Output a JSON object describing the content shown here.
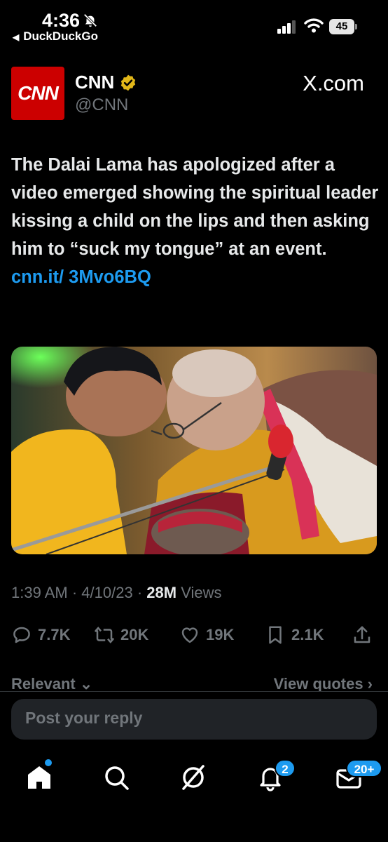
{
  "status_bar": {
    "time": "4:36",
    "back_app": "DuckDuckGo",
    "battery": "45"
  },
  "tweet": {
    "display_name": "CNN",
    "handle": "@CNN",
    "source": "X.com",
    "avatar_text": "CNN",
    "text": "The Dalai Lama has apologized after a video emerged showing the spiritual leader kissing a child on the lips and then asking him to “suck my tongue” at an event. ",
    "link": "cnn.it/ 3Mvo6BQ",
    "time": "1:39 AM",
    "date": "4/10/23",
    "views_count": "28M",
    "views_label": "Views"
  },
  "actions": {
    "replies": "7.7K",
    "reposts": "20K",
    "likes": "19K",
    "bookmarks": "2.1K"
  },
  "replies_header": {
    "sort_label": "Relevant ⌄",
    "view_quotes": "View quotes ›"
  },
  "reply_placeholder": "Post your reply",
  "nav": {
    "notifications_badge": "2",
    "messages_badge": "20+"
  },
  "colors": {
    "background": "#000000",
    "accent": "#1d9bf0",
    "cnn_red": "#cc0000",
    "verified_gold": "#e2b719",
    "muted": "#71767b"
  }
}
